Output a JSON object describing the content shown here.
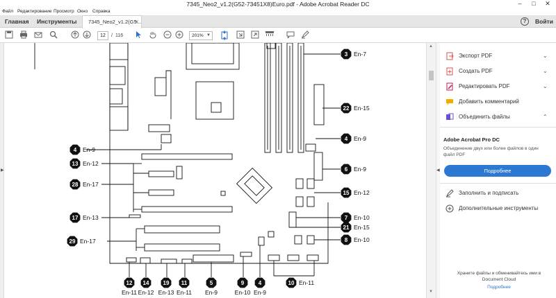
{
  "window": {
    "title": "7345_Neo2_v1.2(G52-73451X8)Euro.pdf - Adobe Acrobat Reader DC",
    "min": "–",
    "max": "□",
    "close": "✕"
  },
  "menu": [
    "Файл",
    "Редактирование",
    "Просмотр",
    "Окно",
    "Справка"
  ],
  "tabs": {
    "home": "Главная",
    "tools": "Инструменты",
    "document": "7345_Neo2_v1.2(G5...",
    "close": "×",
    "help": "?",
    "signin": "Войти"
  },
  "toolbar": {
    "icons": [
      "save-icon",
      "print-icon",
      "email-icon",
      "search-icon",
      "prev-page-icon",
      "next-page-icon",
      "select-cursor-icon",
      "hand-icon",
      "zoom-out-icon",
      "zoom-in-icon",
      "fit-page-icon",
      "scroll-mode-icon",
      "full-screen-icon",
      "rotate-icon",
      "comment-icon",
      "highlight-icon"
    ],
    "page_current": "12",
    "page_sep": "/",
    "page_total": "116",
    "zoom": "201%"
  },
  "document": {
    "callouts": [
      {
        "num": "3",
        "label": "En-7"
      },
      {
        "num": "22",
        "label": "En-15"
      },
      {
        "num": "4",
        "label": "En-9"
      },
      {
        "num": "4",
        "label": "En-9"
      },
      {
        "num": "13",
        "label": "En-12"
      },
      {
        "num": "6",
        "label": "En-9"
      },
      {
        "num": "28",
        "label": "En-17"
      },
      {
        "num": "15",
        "label": "En-12"
      },
      {
        "num": "17",
        "label": "En-13"
      },
      {
        "num": "7",
        "label": "En-10"
      },
      {
        "num": "21",
        "label": "En-15"
      },
      {
        "num": "29",
        "label": "En-17"
      },
      {
        "num": "8",
        "label": "En-10"
      },
      {
        "num": "12",
        "label": "En-11"
      },
      {
        "num": "14",
        "label": "En-12"
      },
      {
        "num": "19",
        "label": "En-13"
      },
      {
        "num": "11",
        "label": "En-11"
      },
      {
        "num": "5",
        "label": "En-9"
      },
      {
        "num": "9",
        "label": "En-10"
      },
      {
        "num": "4",
        "label": "En-9"
      },
      {
        "num": "10",
        "label": "En-11"
      }
    ]
  },
  "pane": {
    "tools": [
      {
        "label": "Экспорт PDF",
        "icon": "export-pdf-icon",
        "color": "#d9534f"
      },
      {
        "label": "Создать PDF",
        "icon": "create-pdf-icon",
        "color": "#d9534f"
      },
      {
        "label": "Редактировать PDF",
        "icon": "edit-pdf-icon",
        "color": "#c2185b"
      },
      {
        "label": "Добавить комментарий",
        "icon": "comment-tool-icon",
        "color": "#f0ad00"
      },
      {
        "label": "Объединить файлы",
        "icon": "combine-files-icon",
        "color": "#6c4fd1"
      }
    ],
    "promo": {
      "title": "Adobe Acrobat Pro DC",
      "desc": "Объединение двух или более файлов в один файл PDF",
      "button": "Подробнее"
    },
    "more_tools": [
      {
        "label": "Заполнить и подписать",
        "icon": "fill-sign-icon"
      },
      {
        "label": "Дополнительные инструменты",
        "icon": "more-tools-icon"
      }
    ],
    "cloud_text": "Храните файлы и обменивайтесь ими в Document Cloud",
    "cloud_link": "Подробнее"
  },
  "colors": {
    "accent": "#2d78d3"
  }
}
